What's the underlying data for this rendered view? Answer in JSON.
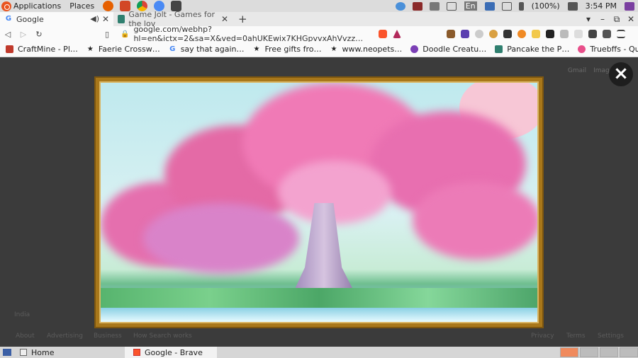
{
  "system_panel": {
    "applications_label": "Applications",
    "places_label": "Places",
    "tray": {
      "keyboard_layout": "En",
      "battery": "(100%)",
      "clock": "3:54 PM"
    }
  },
  "browser": {
    "tabs": [
      {
        "label": "Google",
        "icon": "google-icon",
        "active": true
      },
      {
        "label": "Game Jolt - Games for the lov",
        "icon": "gamejolt-icon",
        "active": false
      }
    ],
    "new_tab_label": "+",
    "url": "google.com/webhp?hl=en&ictx=2&sa=X&ved=0ahUKEwix7KHGpvvxAhVvzz…",
    "bookmarks": [
      {
        "label": "CraftMine - Pl…",
        "icon": "craftmine-icon"
      },
      {
        "label": "Faerie Crossw…",
        "icon": "star-icon"
      },
      {
        "label": "say that again…",
        "icon": "google-icon"
      },
      {
        "label": "Free gifts fro…",
        "icon": "star-icon"
      },
      {
        "label": "www.neopets…",
        "icon": "star-icon"
      },
      {
        "label": "Doodle Creatu…",
        "icon": "doodle-icon"
      },
      {
        "label": "Pancake the P…",
        "icon": "gamejolt-icon"
      },
      {
        "label": "Truebffs - Qui…",
        "icon": "truebffs-icon"
      }
    ]
  },
  "google": {
    "gmail": "Gmail",
    "images": "Images",
    "close": "×",
    "country": "India",
    "footer_left": [
      "About",
      "Advertising",
      "Business",
      "How Search works"
    ],
    "footer_right": [
      "Privacy",
      "Terms",
      "Settings"
    ]
  },
  "taskbar": {
    "items": [
      {
        "label": "Home"
      },
      {
        "label": "Google - Brave"
      }
    ]
  },
  "colors": {
    "brand_orange": "#e95420",
    "brave_orange": "#fb542b",
    "frame_gold": "#a8771a"
  }
}
